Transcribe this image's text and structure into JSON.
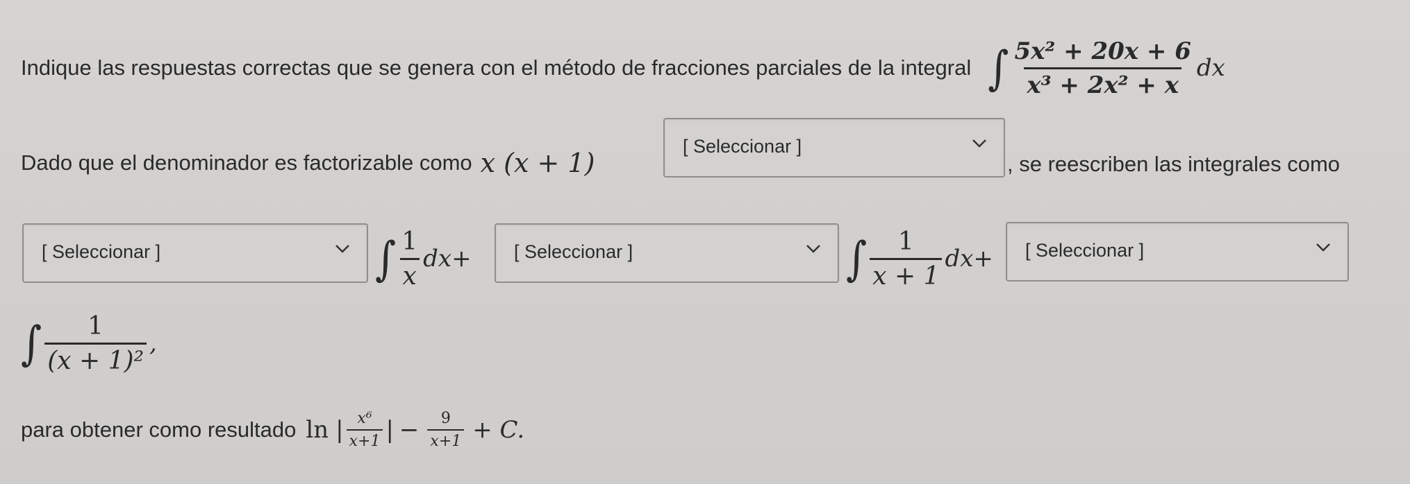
{
  "question": {
    "intro": "Indique las respuestas correctas que se genera con el método de fracciones parciales de la integral",
    "integral": {
      "sign": "∫",
      "numerator": "5x² + 20x + 6",
      "denominator": "x³ + 2x² + x",
      "differential": "dx"
    }
  },
  "sentence2": {
    "prefix": "Dado que el denominador es factorizable como",
    "factor": "x (x + 1)",
    "suffix": ", se reescriben las integrales como"
  },
  "decomposition": {
    "term1": {
      "sign": "∫",
      "numerator": "1",
      "denominator": "x",
      "after": "dx+"
    },
    "term2": {
      "sign": "∫",
      "numerator": "1",
      "denominator": "x + 1",
      "after": "dx+"
    },
    "term3": {
      "sign": "∫",
      "numerator": "1",
      "denominator": "(x + 1)²",
      "after": ","
    }
  },
  "dropdowns": {
    "select1": {
      "selected": "[ Seleccionar ]"
    },
    "select2": {
      "selected": "[ Seleccionar ]"
    },
    "select3": {
      "selected": "[ Seleccionar ]"
    },
    "select4": {
      "selected": "[ Seleccionar ]"
    }
  },
  "result": {
    "prefix": "para obtener como resultado",
    "ln": "ln",
    "abs_open": "|",
    "abs_num": "x⁶",
    "abs_den": "x+1",
    "abs_close": "|",
    "minus": "−",
    "frac2_num": "9",
    "frac2_den": "x+1",
    "tail": "+ C."
  },
  "icons": {
    "dropdown": "chevron-down-icon"
  }
}
